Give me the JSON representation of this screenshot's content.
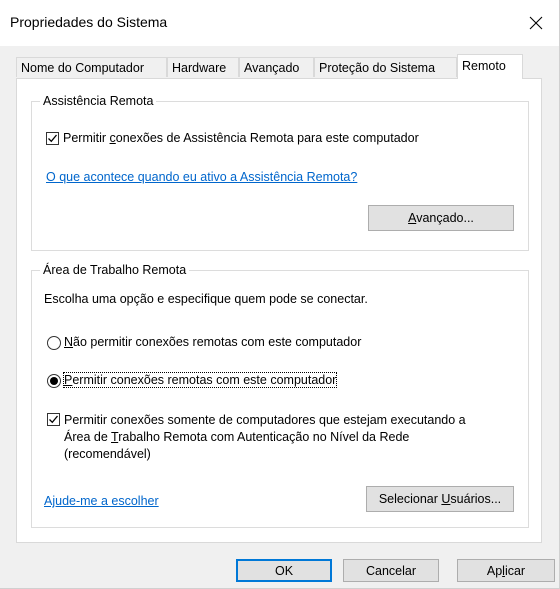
{
  "window": {
    "title": "Propriedades do Sistema"
  },
  "tabs": [
    {
      "label": "Nome do Computador",
      "active": false
    },
    {
      "label": "Hardware",
      "active": false
    },
    {
      "label": "Avançado",
      "active": false
    },
    {
      "label": "Proteção do Sistema",
      "active": false
    },
    {
      "label": "Remoto",
      "active": true
    }
  ],
  "remote_assistance": {
    "group_title": "Assistência Remota",
    "allow_checkbox": {
      "checked": true,
      "label_pre": "Permitir ",
      "label_accel": "c",
      "label_post": "onexões de Assistência Remota para este computador"
    },
    "help_link": "O que acontece quando eu ativo a Assistência Remota?",
    "advanced_button": {
      "accel": "A",
      "rest": "vançado..."
    }
  },
  "remote_desktop": {
    "group_title": "Área de Trabalho Remota",
    "instruction": "Escolha uma opção e especifique quem pode se conectar.",
    "option_deny": {
      "selected": false,
      "label_accel": "N",
      "label_rest": "ão permitir conexões remotas com este computador"
    },
    "option_allow": {
      "selected": true,
      "label_accel": "P",
      "label_rest": "ermitir conexões remotas com este computador"
    },
    "nla_checkbox": {
      "checked": true,
      "line1": "Permitir conexões somente de computadores que estejam executando a",
      "line2_pre": "Área de ",
      "line2_accel": "T",
      "line2_post": "rabalho Remota com Autenticação no Nível da Rede",
      "line3": "(recomendável)"
    },
    "help_link": "Ajude-me a escolher",
    "select_users_button": {
      "pre": "Selecionar ",
      "accel": "U",
      "post": "suários..."
    }
  },
  "footer": {
    "ok": "OK",
    "cancel": "Cancelar",
    "apply_pre": "Ap",
    "apply_accel": "l",
    "apply_post": "icar"
  }
}
